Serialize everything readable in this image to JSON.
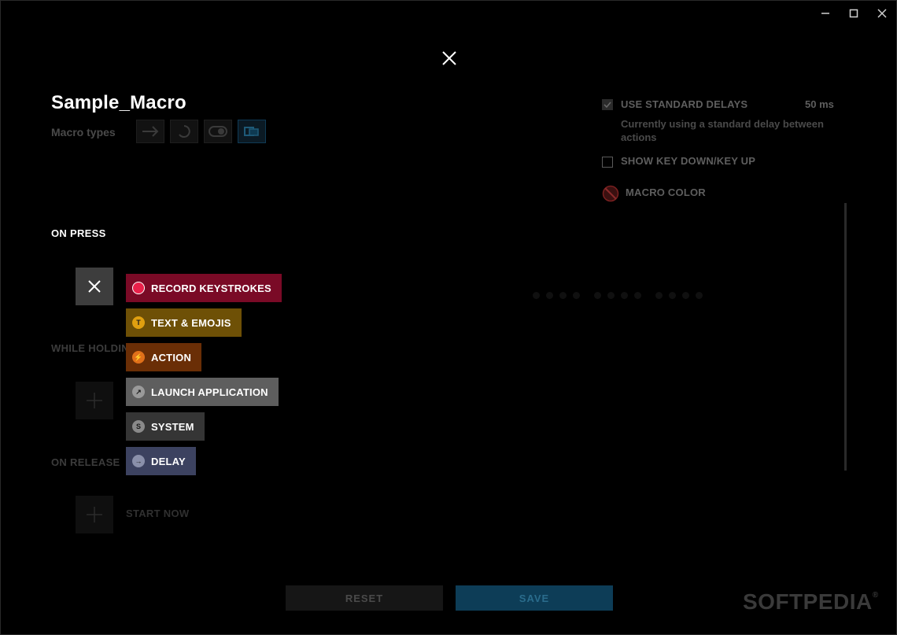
{
  "window": {
    "minimize_icon": "minimize-icon",
    "maximize_icon": "maximize-icon",
    "close_icon": "close-icon"
  },
  "macro": {
    "name": "Sample_Macro",
    "types_label": "Macro types"
  },
  "sections": {
    "on_press": "ON PRESS",
    "while_holding": "WHILE HOLDIN",
    "on_release": "ON RELEASE",
    "start_now": "START NOW"
  },
  "menu": {
    "options": [
      {
        "label": "RECORD KEYSTROKES",
        "bg": "#7a0a26",
        "icon_bg": "#e8204a",
        "icon_text": ""
      },
      {
        "label": "TEXT & EMOJIS",
        "bg": "#6e5006",
        "icon_bg": "#e0a010",
        "icon_text": "T"
      },
      {
        "label": "ACTION",
        "bg": "#6a2e06",
        "icon_bg": "#e0701a",
        "icon_text": "⚡"
      },
      {
        "label": "LAUNCH APPLICATION",
        "bg": "#5e5e5e",
        "icon_bg": "#9a9a9a",
        "icon_text": "↗"
      },
      {
        "label": "SYSTEM",
        "bg": "#353535",
        "icon_bg": "#8a8a8a",
        "icon_text": "S"
      },
      {
        "label": "DELAY",
        "bg": "#3c4260",
        "icon_bg": "#8a90aa",
        "icon_text": "→"
      }
    ]
  },
  "settings": {
    "standard_delays_label": "USE STANDARD DELAYS",
    "standard_delays_checked": true,
    "standard_delays_ms": "50 ms",
    "standard_delays_desc": "Currently using a standard delay between actions",
    "show_key_down_up_label": "SHOW KEY DOWN/KEY UP",
    "show_key_down_up_checked": false,
    "macro_color_label": "MACRO COLOR"
  },
  "buttons": {
    "reset": "RESET",
    "save": "SAVE"
  },
  "watermark": {
    "text": "SOFTPEDIA",
    "mark": "®"
  }
}
